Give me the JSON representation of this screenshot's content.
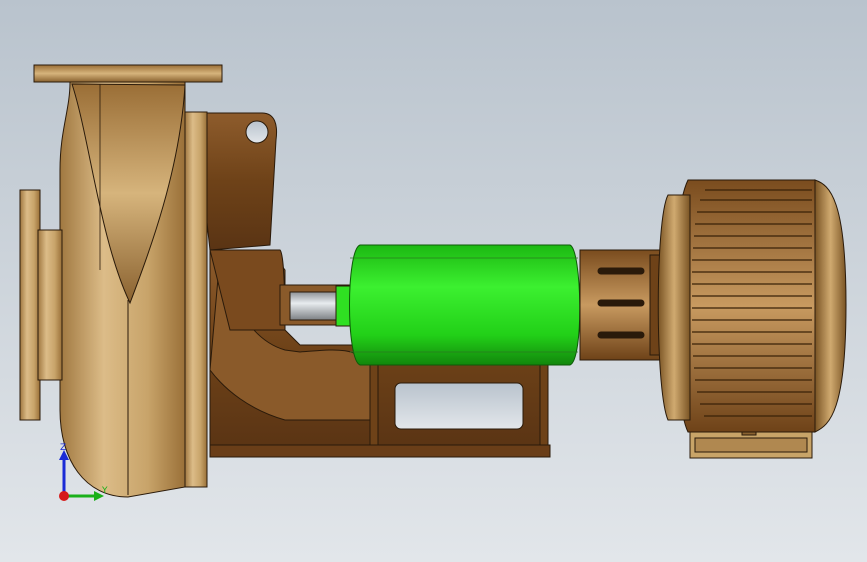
{
  "viewport": {
    "background_top": "#b8c2cc",
    "background_bottom": "#e0e4e8"
  },
  "colors": {
    "bronze_light": "#d9b985",
    "bronze_mid": "#c09a5c",
    "bronze_dark": "#8a6230",
    "brown": "#7d4c22",
    "brown_dark": "#5a3414",
    "green": "#29e01e",
    "green_dark": "#1a9a12",
    "shaft": "#c8ccd0",
    "outline": "#2a1a0a"
  },
  "triad": {
    "z_label": "Z",
    "y_label": "Y",
    "z_color": "#1a2bd6",
    "y_color": "#19b019",
    "x_color": "#d61a1a",
    "icon": "coordinate-triad-icon"
  }
}
